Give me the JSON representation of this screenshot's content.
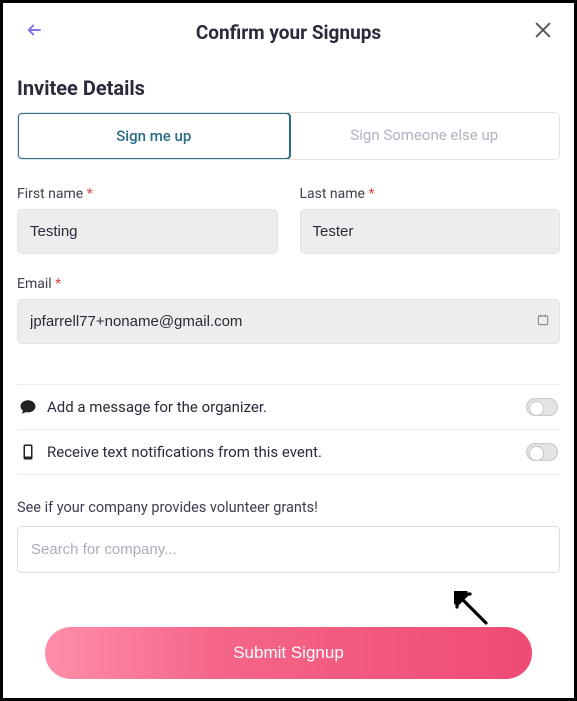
{
  "header": {
    "title": "Confirm your Signups"
  },
  "section_title": "Invitee Details",
  "tabs": {
    "self": "Sign me up",
    "other": "Sign Someone else up"
  },
  "fields": {
    "first_name_label": "First name",
    "first_name_value": "Testing",
    "last_name_label": "Last name",
    "last_name_value": "Tester",
    "email_label": "Email",
    "email_value": "jpfarrell77+noname@gmail.com"
  },
  "required_marker": "*",
  "options": {
    "message": "Add a message for the organizer.",
    "notifications": "Receive text notifications from this event."
  },
  "grants_helper": "See if your company provides volunteer grants!",
  "company_placeholder": "Search for company...",
  "submit_label": "Submit Signup"
}
